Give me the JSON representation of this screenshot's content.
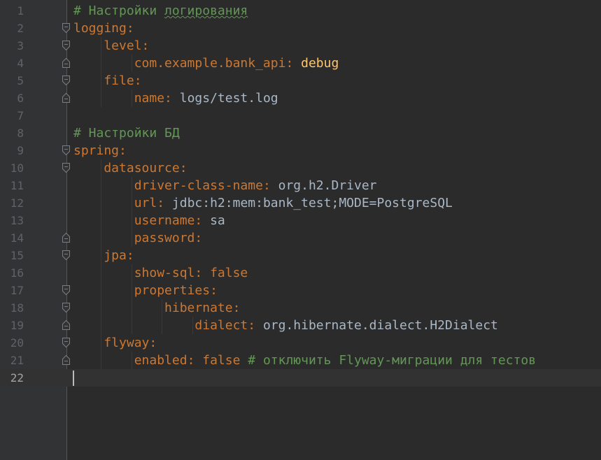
{
  "editor": {
    "current_line": 22,
    "lines": [
      {
        "num": "1",
        "parts": [
          [
            "c",
            "# Настройки "
          ],
          [
            "cu",
            "логирования"
          ]
        ],
        "fold": null
      },
      {
        "num": "2",
        "parts": [
          [
            "k",
            "logging"
          ],
          [
            "p",
            ":"
          ]
        ],
        "fold": "open"
      },
      {
        "num": "3",
        "parts": [
          [
            "k",
            "    level"
          ],
          [
            "p",
            ":"
          ]
        ],
        "fold": "open"
      },
      {
        "num": "4",
        "parts": [
          [
            "k",
            "        com.example.bank_api"
          ],
          [
            "p",
            ": "
          ],
          [
            "s",
            "debug"
          ]
        ],
        "fold": "close"
      },
      {
        "num": "5",
        "parts": [
          [
            "k",
            "    file"
          ],
          [
            "p",
            ":"
          ]
        ],
        "fold": "open"
      },
      {
        "num": "6",
        "parts": [
          [
            "k",
            "        name"
          ],
          [
            "p",
            ": "
          ],
          [
            "v",
            "logs/test.log"
          ]
        ],
        "fold": "close"
      },
      {
        "num": "7",
        "parts": [],
        "fold": null
      },
      {
        "num": "8",
        "parts": [
          [
            "c",
            "# Настройки БД"
          ]
        ],
        "fold": null
      },
      {
        "num": "9",
        "parts": [
          [
            "k",
            "spring"
          ],
          [
            "p",
            ":"
          ]
        ],
        "fold": "open"
      },
      {
        "num": "10",
        "parts": [
          [
            "k",
            "    datasource"
          ],
          [
            "p",
            ":"
          ]
        ],
        "fold": "open"
      },
      {
        "num": "11",
        "parts": [
          [
            "k",
            "        driver-class-name"
          ],
          [
            "p",
            ": "
          ],
          [
            "v",
            "org.h2.Driver"
          ]
        ],
        "fold": null
      },
      {
        "num": "12",
        "parts": [
          [
            "k",
            "        url"
          ],
          [
            "p",
            ": "
          ],
          [
            "v",
            "jdbc:h2:mem:bank_test;MODE=PostgreSQL"
          ]
        ],
        "fold": null
      },
      {
        "num": "13",
        "parts": [
          [
            "k",
            "        username"
          ],
          [
            "p",
            ": "
          ],
          [
            "v",
            "sa"
          ]
        ],
        "fold": null
      },
      {
        "num": "14",
        "parts": [
          [
            "k",
            "        password"
          ],
          [
            "p",
            ":"
          ]
        ],
        "fold": "close"
      },
      {
        "num": "15",
        "parts": [
          [
            "k",
            "    jpa"
          ],
          [
            "p",
            ":"
          ]
        ],
        "fold": "open"
      },
      {
        "num": "16",
        "parts": [
          [
            "k",
            "        show-sql"
          ],
          [
            "p",
            ": "
          ],
          [
            "k",
            "false"
          ]
        ],
        "fold": null
      },
      {
        "num": "17",
        "parts": [
          [
            "k",
            "        properties"
          ],
          [
            "p",
            ":"
          ]
        ],
        "fold": "open"
      },
      {
        "num": "18",
        "parts": [
          [
            "k",
            "            hibernate"
          ],
          [
            "p",
            ":"
          ]
        ],
        "fold": "open"
      },
      {
        "num": "19",
        "parts": [
          [
            "k",
            "                dialect"
          ],
          [
            "p",
            ": "
          ],
          [
            "v",
            "org.hibernate.dialect.H2Dialect"
          ]
        ],
        "fold": "close"
      },
      {
        "num": "20",
        "parts": [
          [
            "k",
            "    flyway"
          ],
          [
            "p",
            ":"
          ]
        ],
        "fold": "open"
      },
      {
        "num": "21",
        "parts": [
          [
            "k",
            "        enabled"
          ],
          [
            "p",
            ": "
          ],
          [
            "k",
            "false"
          ],
          [
            "c",
            " # отключить Flyway-миграции для тестов"
          ]
        ],
        "fold": "close"
      },
      {
        "num": "22",
        "parts": [],
        "fold": null
      }
    ]
  },
  "colors": {
    "background": "#2b2b2b",
    "gutter": "#313335",
    "key": "#cc7832",
    "value": "#a9b7c6",
    "string": "#ffc66d",
    "comment": "#629755",
    "line_number": "#606366"
  }
}
